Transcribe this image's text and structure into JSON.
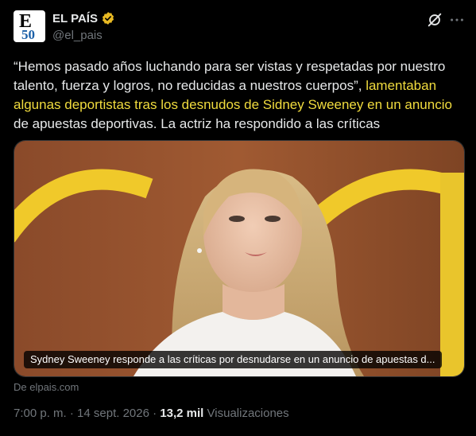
{
  "post": {
    "author_name": "EL PAÍS",
    "handle": "@el_pais",
    "avatar_letter": "E",
    "avatar_number": "50",
    "text_plain": "“Hemos pasado años luchando para ser vistas y respetadas por nuestro talento, fuerza y logros, no reducidas a nuestros cuerpos”, ",
    "text_link": "lamentaban algunas deportistas tras los desnudos de Sidney Sweeney en un anuncio",
    "text_tail": " de apuestas deportivas. La actriz ha respondido a las críticas",
    "card_caption": "Sydney Sweeney responde a las críticas por desnudarse en un anuncio de apuestas d...",
    "card_source": "De elpais.com",
    "time": "7:00 p. m.",
    "separator": "·",
    "date": "14 sept. 2026",
    "views_count": "13,2 mil",
    "views_label": "Visualizaciones"
  },
  "colors": {
    "background": "#000000",
    "link": "#f1dc3e",
    "muted": "#71767b",
    "verified_badge": "#e8b923"
  },
  "icons": {
    "verified": "verified-badge-icon",
    "grok": "grok-icon",
    "more": "more-options-icon"
  }
}
